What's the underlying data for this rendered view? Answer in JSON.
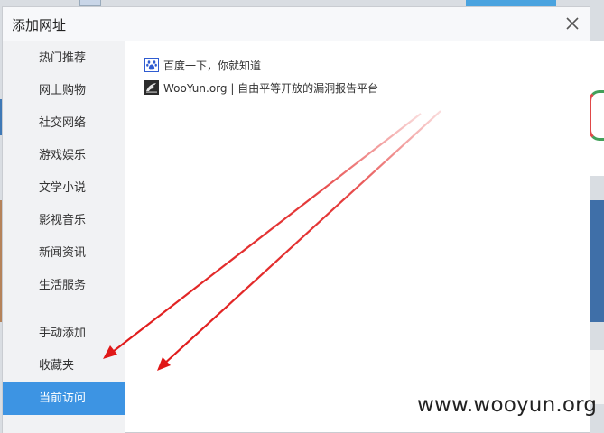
{
  "dialog": {
    "title": "添加网址",
    "close_icon": "close-icon"
  },
  "sidebar": {
    "categories": [
      {
        "label": "热门推荐"
      },
      {
        "label": "网上购物"
      },
      {
        "label": "社交网络"
      },
      {
        "label": "游戏娱乐"
      },
      {
        "label": "文学小说"
      },
      {
        "label": "影视音乐"
      },
      {
        "label": "新闻资讯"
      },
      {
        "label": "生活服务"
      }
    ],
    "actions": [
      {
        "label": "手动添加"
      },
      {
        "label": "收藏夹"
      },
      {
        "label": "当前访问",
        "active": true
      }
    ],
    "active_color": "#3d94e3"
  },
  "sites": [
    {
      "title": "百度一下，你就知道",
      "icon": "baidu-paw-icon"
    },
    {
      "title": "WooYun.org | 自由平等开放的漏洞报告平台",
      "icon": "wooyun-logo-icon"
    }
  ],
  "annotation": {
    "arrow_color": "#e01818"
  },
  "watermark": "www.wooyun.org"
}
